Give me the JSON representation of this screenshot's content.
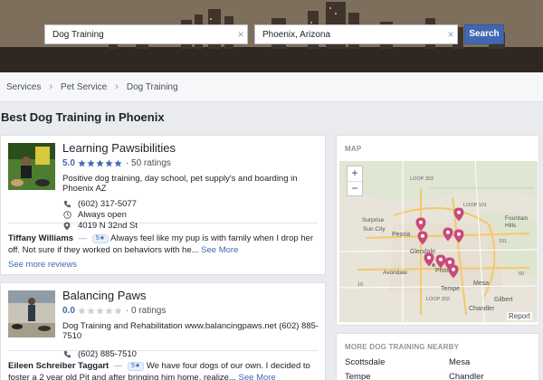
{
  "search": {
    "query_value": "Dog Training",
    "location_value": "Phoenix, Arizona",
    "button_label": "Search",
    "clear_glyph": "×"
  },
  "breadcrumb": {
    "items": [
      "Services",
      "Pet Service",
      "Dog Training"
    ],
    "separator": "›"
  },
  "page_title": "Best Dog Training in Phoenix",
  "businesses": [
    {
      "name": "Learning Pawsibilities",
      "rating": "5.0",
      "stars": 5,
      "ratings_count": "· 50 ratings",
      "description": "Positive dog training, day school, pet supply's and boarding in Phoenix AZ",
      "phone": "(602) 317-5077",
      "hours": "Always open",
      "address": "4019 N 32nd St",
      "review": {
        "author": "Tiffany Williams",
        "dash": "—",
        "badge": "5★",
        "text": "Always feel like my pup is with family when I drop her off. Not sure if they worked on behaviors with he...",
        "see_more": "See More"
      },
      "see_more_reviews": "See more reviews"
    },
    {
      "name": "Balancing Paws",
      "rating": "0.0",
      "stars": 0,
      "ratings_count": "· 0 ratings",
      "description": "Dog Training and Rehabilitation www.balancingpaws.net (602) 885-7510",
      "phone": "(602) 885-7510",
      "review": {
        "author": "Eileen Schreiber Taggart",
        "dash": "—",
        "badge": "5★",
        "text": "We have four dogs of our own. I decided to foster a 2 year old Pit and after bringing him home, realize...",
        "see_more": "See More"
      }
    }
  ],
  "map": {
    "label": "MAP",
    "zoom_in": "+",
    "zoom_out": "−",
    "report": "Report",
    "places": [
      "Peoria",
      "Glendale",
      "Phoenix",
      "Tempe",
      "Mesa",
      "Chandler",
      "Gilbert",
      "Fountain Hills",
      "Surprise",
      "Sun City",
      "Avondale"
    ],
    "roads": [
      "LOOP 303",
      "LOOP 101",
      "101",
      "LOOP 202",
      "60",
      "10"
    ]
  },
  "nearby": {
    "label": "MORE DOG TRAINING NEARBY",
    "places": [
      "Scottsdale",
      "Mesa",
      "Tempe",
      "Chandler"
    ]
  },
  "colors": {
    "accent": "#4267b2",
    "star": "#4267b2",
    "pin": "#c9497a",
    "background": "#e9ebee"
  }
}
